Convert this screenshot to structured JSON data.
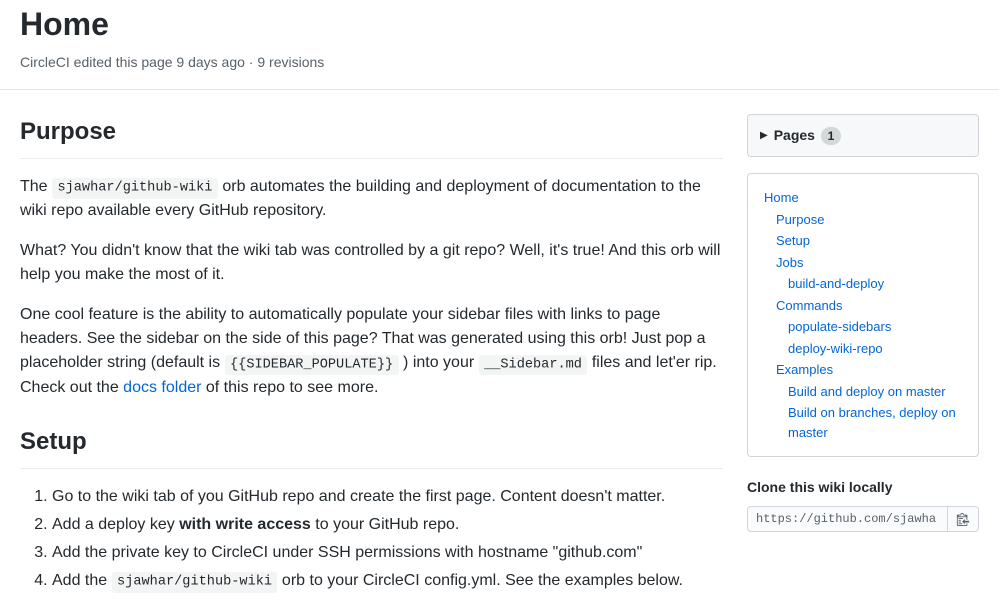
{
  "header": {
    "title": "Home",
    "subtitle": "CircleCI edited this page 9 days ago · 9 revisions"
  },
  "sections": {
    "purpose": {
      "heading": "Purpose",
      "p1_pre": "The ",
      "p1_code": "sjawhar/github-wiki",
      "p1_post": " orb automates the building and deployment of documentation to the wiki repo available every GitHub repository.",
      "p2": "What? You didn't know that the wiki tab was controlled by a git repo? Well, it's true! And this orb will help you make the most of it.",
      "p3_a": "One cool feature is the ability to automatically populate your sidebar files with links to page headers. See the sidebar on the side of this page? That was generated using this orb! Just pop a placeholder string (default is ",
      "p3_code1": "{{SIDEBAR_POPULATE}}",
      "p3_b": " ) into your ",
      "p3_code2": "__Sidebar.md",
      "p3_c": " files and let'er rip. Check out the ",
      "p3_link": "docs folder",
      "p3_d": " of this repo to see more."
    },
    "setup": {
      "heading": "Setup",
      "step1": "Go to the wiki tab of you GitHub repo and create the first page. Content doesn't matter.",
      "step2_a": "Add a deploy key ",
      "step2_b": "with write access",
      "step2_c": " to your GitHub repo.",
      "step3": "Add the private key to CircleCI under SSH permissions with hostname \"github.com\"",
      "step4_a": "Add the ",
      "step4_code": "sjawhar/github-wiki",
      "step4_b": " orb to your CircleCI config.yml. See the examples below."
    }
  },
  "sidebar": {
    "pages": {
      "label": "Pages",
      "count": "1"
    },
    "toc": {
      "home": "Home",
      "purpose": "Purpose",
      "setup": "Setup",
      "jobs": "Jobs",
      "build_deploy": "build-and-deploy",
      "commands": "Commands",
      "pop_sidebars": "populate-sidebars",
      "deploy_wiki": "deploy-wiki-repo",
      "examples": "Examples",
      "ex1": "Build and deploy on master",
      "ex2": "Build on branches, deploy on master"
    },
    "clone": {
      "title": "Clone this wiki locally",
      "url": "https://github.com/sjawha"
    }
  }
}
